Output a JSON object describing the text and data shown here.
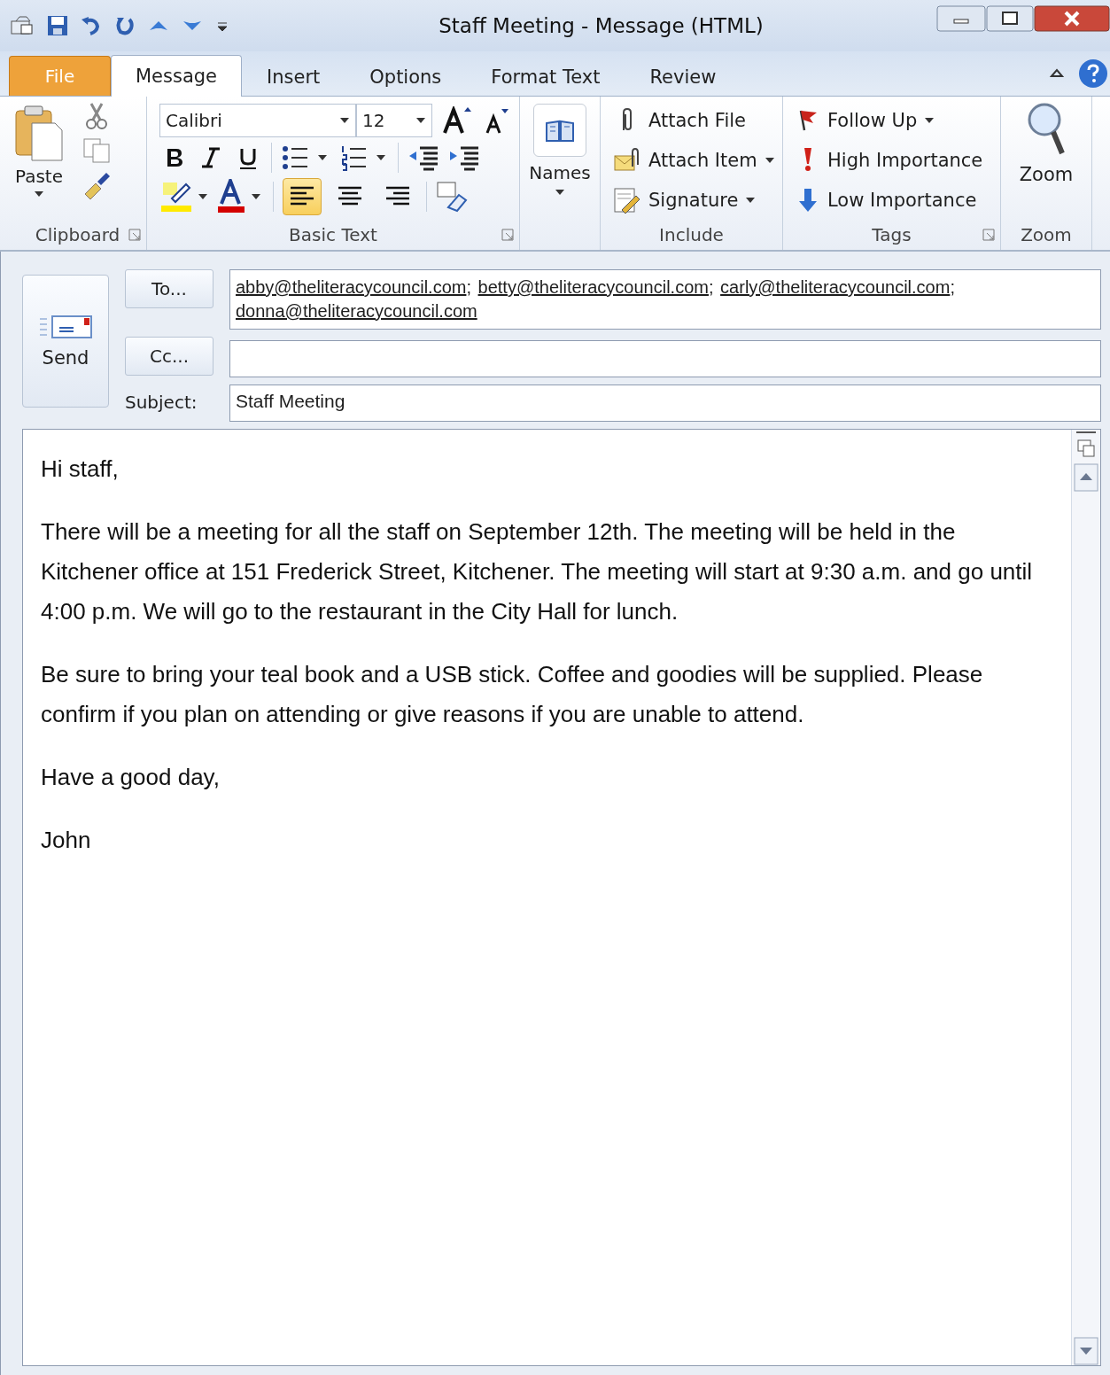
{
  "window": {
    "title": "Staff Meeting  -  Message (HTML)"
  },
  "tabs": [
    {
      "label": "File",
      "kind": "file",
      "selected": false
    },
    {
      "label": "Message",
      "kind": "tab",
      "selected": true
    },
    {
      "label": "Insert",
      "kind": "tab",
      "selected": false
    },
    {
      "label": "Options",
      "kind": "tab",
      "selected": false
    },
    {
      "label": "Format Text",
      "kind": "tab",
      "selected": false
    },
    {
      "label": "Review",
      "kind": "tab",
      "selected": false
    }
  ],
  "ribbon": {
    "clipboard": {
      "label": "Clipboard",
      "paste": "Paste"
    },
    "basic_text": {
      "label": "Basic Text",
      "font": "Calibri",
      "size": "12",
      "alignment": [
        {
          "kind": "left",
          "selected": true
        },
        {
          "kind": "center",
          "selected": false
        },
        {
          "kind": "right",
          "selected": false
        }
      ]
    },
    "names": {
      "button": "Names"
    },
    "include": {
      "label": "Include",
      "items": [
        {
          "kind": "file",
          "label": "Attach File",
          "dropdown": false
        },
        {
          "kind": "item",
          "label": "Attach Item",
          "dropdown": true
        },
        {
          "kind": "signature",
          "label": "Signature",
          "dropdown": true
        }
      ]
    },
    "tags": {
      "label": "Tags",
      "items": [
        {
          "kind": "flag",
          "label": "Follow Up",
          "dropdown": true
        },
        {
          "kind": "high",
          "label": "High Importance",
          "dropdown": false
        },
        {
          "kind": "low",
          "label": "Low Importance",
          "dropdown": false
        }
      ]
    },
    "zoom": {
      "button": "Zoom",
      "label": "Zoom"
    }
  },
  "header": {
    "send": "Send",
    "to_button": "To...",
    "to": [
      "abby@theliteracycouncil.com",
      "betty@theliteracycouncil.com",
      "carly@theliteracycouncil.com",
      "donna@theliteracycouncil.com"
    ],
    "separator": ";",
    "cc_button": "Cc...",
    "subject_label": "Subject:",
    "subject": "Staff Meeting"
  },
  "body": [
    "Hi staff,",
    "There will be a meeting for all the staff on September 12th. The meeting will be held in the Kitchener office at 151 Frederick Street, Kitchener. The meeting will start at 9:30 a.m. and go until 4:00 p.m. We will go to the restaurant in the City Hall for lunch.",
    "Be sure to bring your teal book and a USB stick. Coffee and goodies will be supplied. Please confirm if you plan on attending or give reasons if you are unable to attend.",
    "Have a good day,",
    "John"
  ]
}
